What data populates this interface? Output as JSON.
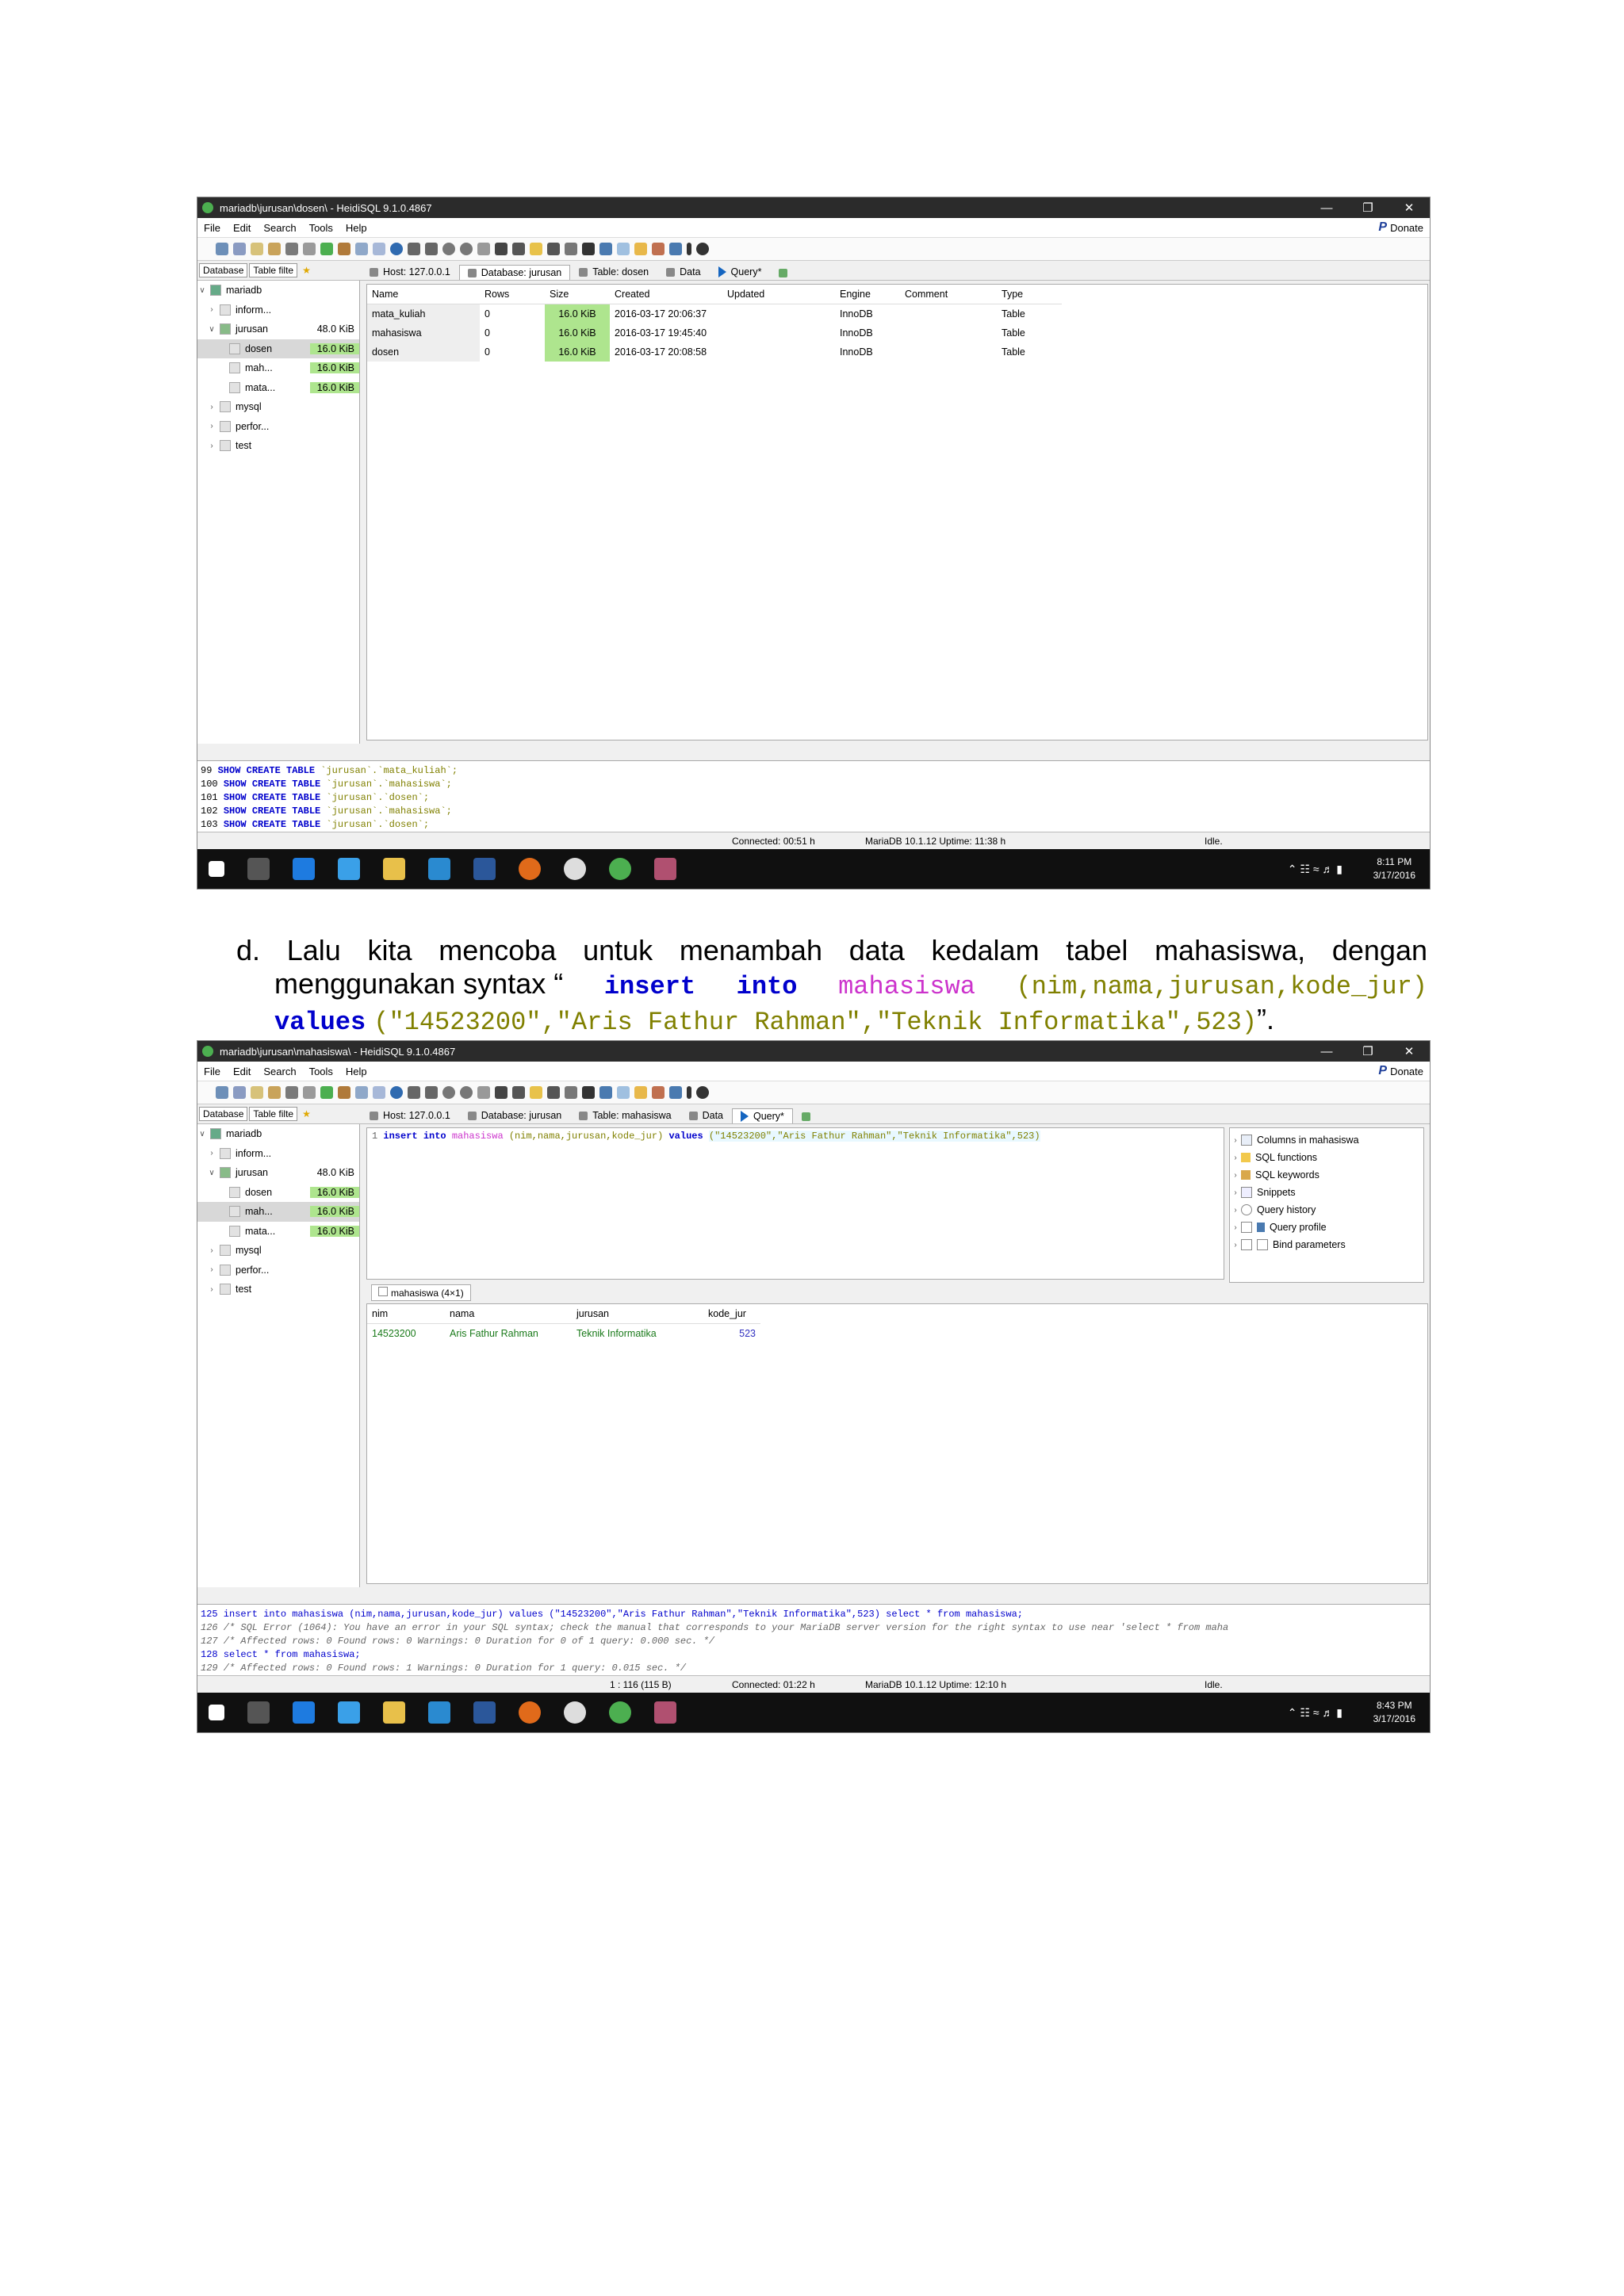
{
  "screenshot1": {
    "window_title": "mariadb\\jurusan\\dosen\\ - HeidiSQL 9.1.0.4867",
    "menu": [
      "File",
      "Edit",
      "Search",
      "Tools",
      "Help"
    ],
    "donate": "Donate",
    "left_tabs": [
      "Database",
      "Table filte"
    ],
    "tabs": [
      "Host: 127.0.0.1",
      "Database: jurusan",
      "Table: dosen",
      "Data",
      "Query*"
    ],
    "tree": [
      {
        "label": "mariadb",
        "size": ""
      },
      {
        "label": "inform...",
        "size": ""
      },
      {
        "label": "jurusan",
        "size": "48.0 KiB"
      },
      {
        "label": "dosen",
        "size": "16.0 KiB"
      },
      {
        "label": "mah...",
        "size": "16.0 KiB"
      },
      {
        "label": "mata...",
        "size": "16.0 KiB"
      },
      {
        "label": "mysql",
        "size": ""
      },
      {
        "label": "perfor...",
        "size": ""
      },
      {
        "label": "test",
        "size": ""
      }
    ],
    "grid_headers": [
      "Name",
      "Rows",
      "Size",
      "Created",
      "Updated",
      "Engine",
      "Comment",
      "Type"
    ],
    "grid_rows": [
      [
        "mata_kuliah",
        "0",
        "16.0 KiB",
        "2016-03-17 20:06:37",
        "",
        "InnoDB",
        "",
        "Table"
      ],
      [
        "mahasiswa",
        "0",
        "16.0 KiB",
        "2016-03-17 19:45:40",
        "",
        "InnoDB",
        "",
        "Table"
      ],
      [
        "dosen",
        "0",
        "16.0 KiB",
        "2016-03-17 20:08:58",
        "",
        "InnoDB",
        "",
        "Table"
      ]
    ],
    "log": [
      {
        "num": "99",
        "kw": "SHOW CREATE TABLE",
        "rest": " `jurusan`.`mata_kuliah`;"
      },
      {
        "num": "100",
        "kw": "SHOW CREATE TABLE",
        "rest": " `jurusan`.`mahasiswa`;"
      },
      {
        "num": "101",
        "kw": "SHOW CREATE TABLE",
        "rest": " `jurusan`.`dosen`;"
      },
      {
        "num": "102",
        "kw": "SHOW CREATE TABLE",
        "rest": " `jurusan`.`mahasiswa`;"
      },
      {
        "num": "103",
        "kw": "SHOW CREATE TABLE",
        "rest": " `jurusan`.`dosen`;"
      }
    ],
    "status_connected": "Connected: 00:51 h",
    "status_server": "MariaDB 10.1.12 Uptime: 11:38 h",
    "status_idle": "Idle.",
    "clock_time": "8:11 PM",
    "clock_date": "3/17/2016"
  },
  "paragraph": {
    "prefix": "d. Lalu kita mencoba untuk menambah data kedalam tabel mahasiswa, dengan",
    "line2_text": "menggunakan syntax “",
    "kw_insert": "insert",
    "kw_into": "into",
    "table": "mahasiswa",
    "cols": "(nim,nama,jurusan,kode_jur)",
    "kw_values": "values",
    "vals": "(\"14523200\",\"Aris Fathur Rahman\",\"Teknik Informatika\",523)",
    "end": "”."
  },
  "screenshot2": {
    "window_title": "mariadb\\jurusan\\mahasiswa\\ - HeidiSQL 9.1.0.4867",
    "menu": [
      "File",
      "Edit",
      "Search",
      "Tools",
      "Help"
    ],
    "donate": "Donate",
    "left_tabs": [
      "Database",
      "Table filte"
    ],
    "tabs": [
      "Host: 127.0.0.1",
      "Database: jurusan",
      "Table: mahasiswa",
      "Data",
      "Query*"
    ],
    "tree": [
      {
        "label": "mariadb",
        "size": ""
      },
      {
        "label": "inform...",
        "size": ""
      },
      {
        "label": "jurusan",
        "size": "48.0 KiB"
      },
      {
        "label": "dosen",
        "size": "16.0 KiB"
      },
      {
        "label": "mah...",
        "size": "16.0 KiB"
      },
      {
        "label": "mata...",
        "size": "16.0 KiB"
      },
      {
        "label": "mysql",
        "size": ""
      },
      {
        "label": "perfor...",
        "size": ""
      },
      {
        "label": "test",
        "size": ""
      }
    ],
    "editor_line_no": "1",
    "editor_kw1": "insert into",
    "editor_tbl": "mahasiswa",
    "editor_cols": "(nim,nama,jurusan,kode_jur)",
    "editor_kw2": "values",
    "editor_vals": "(\"14523200\",\"Aris Fathur Rahman\",\"Teknik Informatika\",523)",
    "helpers": [
      "Columns in mahasiswa",
      "SQL functions",
      "SQL keywords",
      "Snippets",
      "Query history",
      "Query profile",
      "Bind parameters"
    ],
    "result_tab": "mahasiswa (4×1)",
    "result_headers": [
      "nim",
      "nama",
      "jurusan",
      "kode_jur"
    ],
    "result_row": [
      "14523200",
      "Aris Fathur Rahman",
      "Teknik Informatika",
      "523"
    ],
    "log": [
      "125 insert into mahasiswa (nim,nama,jurusan,kode_jur) values (\"14523200\",\"Aris Fathur Rahman\",\"Teknik Informatika\",523)  select * from mahasiswa;",
      "126 /* SQL Error (1064): You have an error in your SQL syntax; check the manual that corresponds to your MariaDB server version for the right syntax to use near 'select * from maha",
      "127 /* Affected rows: 0  Found rows: 0  Warnings: 0  Duration for 0 of 1 query: 0.000 sec. */",
      "128 select * from mahasiswa;",
      "129 /* Affected rows: 0  Found rows: 1  Warnings: 0  Duration for 1 query: 0.015 sec. */"
    ],
    "status_pos": "1 : 116 (115 B)",
    "status_connected": "Connected: 01:22 h",
    "status_server": "MariaDB 10.1.12 Uptime: 12:10 h",
    "status_idle": "Idle.",
    "clock_time": "8:43 PM",
    "clock_date": "3/17/2016"
  }
}
